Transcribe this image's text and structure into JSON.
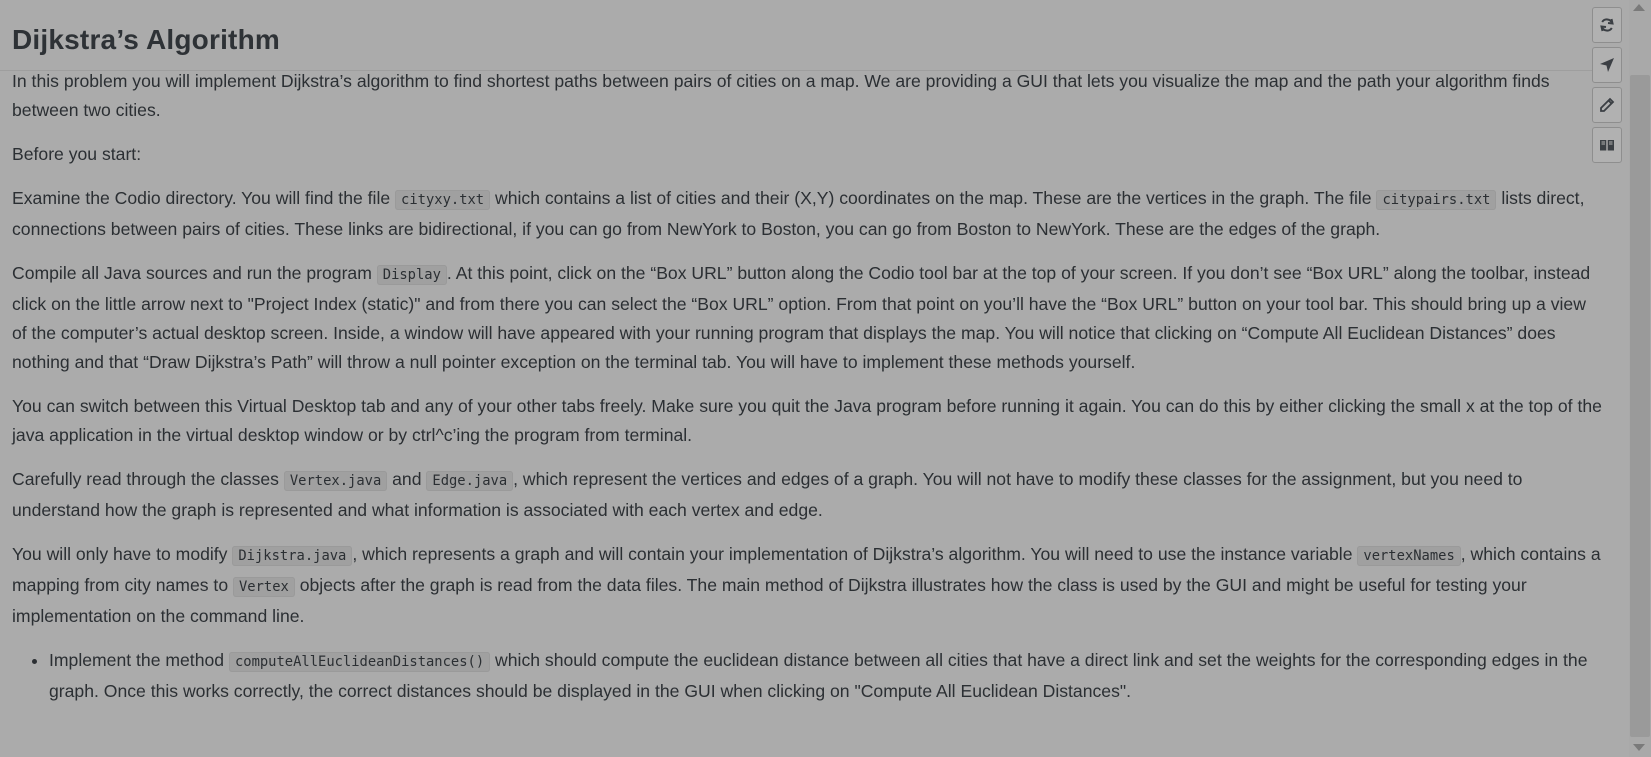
{
  "title": "Dijkstra’s Algorithm",
  "paragraphs": {
    "intro": "In this problem you will implement Dijkstra’s algorithm to find shortest paths between pairs of cities on a map. We are providing a GUI that lets you visualize the map and the path your algorithm finds between two cities.",
    "before": "Before you start:",
    "examine": {
      "t1": "Examine the Codio directory. You will find the file ",
      "c1": "cityxy.txt",
      "t2": " which contains a list of cities and their (X,Y) coordinates on the map. These are the vertices in the graph. The file ",
      "c2": "citypairs.txt",
      "t3": " lists direct, connections between pairs of cities. These links are bidirectional, if you can go from NewYork to Boston, you can go from Boston to NewYork. These are the edges of the graph."
    },
    "compile": {
      "t1": "Compile all Java sources and run the program ",
      "c1": "Display",
      "t2": ". At this point, click on the “Box URL” button along the Codio tool bar at the top of your screen. If you don’t see “Box URL” along the toolbar, instead click on the little arrow next to \"Project Index (static)\" and from there you can select the “Box URL” option. From that point on you’ll have the “Box URL” button on your tool bar. This should bring up a view of the computer’s actual desktop screen. Inside, a window will have appeared with your running program that displays the map. You will notice that clicking on “Compute All Euclidean Distances” does nothing and that “Draw Dijkstra’s Path” will throw a null pointer exception on the terminal tab. You will have to implement these methods yourself."
    },
    "switch": "You can switch between this Virtual Desktop tab and any of your other tabs freely. Make sure you quit the Java program before running it again. You can do this by either clicking the small x at the top of the java application in the virtual desktop window or by ctrl^c’ing the program from terminal.",
    "classes": {
      "t1": "Carefully read through the classes ",
      "c1": "Vertex.java",
      "t2": " and ",
      "c2": "Edge.java",
      "t3": ", which represent the vertices and edges of a graph. You will not have to modify these classes for the assignment, but you need to understand how the graph is represented and what information is associated with each vertex and edge."
    },
    "modify": {
      "t1": "You will only have to modify ",
      "c1": "Dijkstra.java",
      "t2": ", which represents a graph and will contain your implementation of Dijkstra’s algorithm. You will need to use the instance variable ",
      "c2": "vertexNames",
      "t3": ", which contains a mapping from city names to ",
      "c3": "Vertex",
      "t4": " objects after the graph is read from the data files. The main method of Dijkstra illustrates how the class is used by the GUI and might be useful for testing your implementation on the command line."
    },
    "task1": {
      "t1": "Implement the method ",
      "c1": "computeAllEuclideanDistances()",
      "t2": " which should compute the euclidean distance between all cities that have a direct link and set the weights for the corresponding edges in the graph. Once this works correctly, the correct distances should be displayed in the GUI when clicking on \"Compute All Euclidean Distances\"."
    }
  },
  "toolbar": {
    "buttons": [
      {
        "icon": "refresh-icon"
      },
      {
        "icon": "navigate-icon"
      },
      {
        "icon": "pencil-icon"
      },
      {
        "icon": "book-icon"
      }
    ]
  },
  "colors": {
    "background": "#ababab",
    "text": "#2b2f33",
    "code_bg": "#a0a0a0"
  }
}
